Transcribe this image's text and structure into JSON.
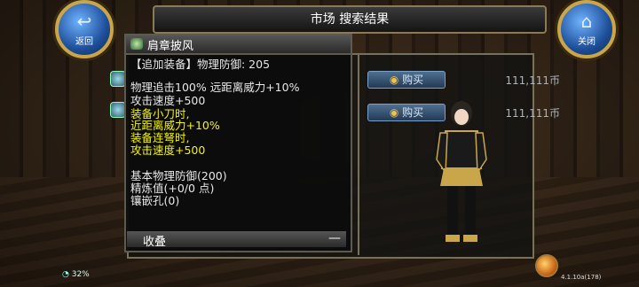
{
  "header": {
    "title": "市场  搜索结果"
  },
  "back_button": {
    "label": "返回",
    "icon": "back-arrow-icon"
  },
  "close_button": {
    "label": "关闭",
    "icon": "home-icon"
  },
  "tooltip": {
    "item_name": "肩章披风",
    "lines": [
      {
        "text": "【追加装备】物理防御: 205",
        "color": "white"
      },
      {
        "text": "",
        "color": "white"
      },
      {
        "text": "物理追击100% 远距离威力+10%",
        "color": "white"
      },
      {
        "text": "攻击速度+500",
        "color": "white"
      },
      {
        "text": "装备小刀时,",
        "color": "yellow"
      },
      {
        "text": "近距离威力+10%",
        "color": "yellow"
      },
      {
        "text": "装备连弩时,",
        "color": "yellow"
      },
      {
        "text": "攻击速度+500",
        "color": "yellow"
      },
      {
        "text": "",
        "color": "white"
      },
      {
        "text": "基本物理防御(200)",
        "color": "white"
      },
      {
        "text": "精炼值(+0/0 点)",
        "color": "white"
      },
      {
        "text": "镶嵌孔(0)",
        "color": "white"
      }
    ],
    "collapse_label": "收叠",
    "collapse_symbol": "—"
  },
  "listings": [
    {
      "buy_label": "购买",
      "price": "111,111币"
    },
    {
      "buy_label": "购买",
      "price": "111,111币"
    }
  ],
  "hud": {
    "battery": "32%",
    "version": "4.1.10a(178)"
  },
  "colors": {
    "yellow_text": "#f4f500",
    "accent_gold": "#c9a64a"
  }
}
